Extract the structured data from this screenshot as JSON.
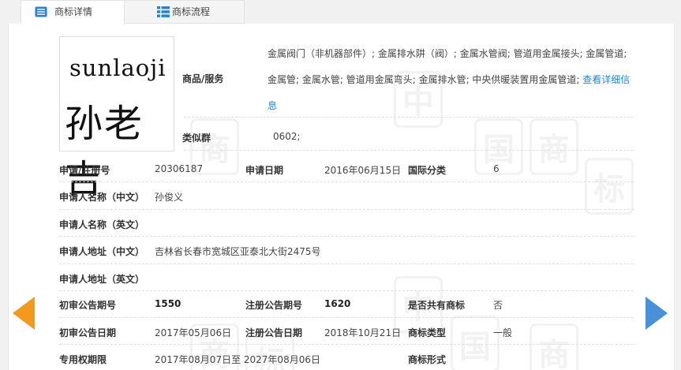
{
  "tabs": [
    {
      "label": "商标详情",
      "icon": "document-list-icon"
    },
    {
      "label": "商标流程",
      "icon": "grid-list-icon"
    }
  ],
  "logo": {
    "en": "sunlaoji",
    "cn": "孙老吉"
  },
  "goods": {
    "label": "商品/服务",
    "text": "金属阀门（非机器部件）; 金属排水阱（阀）; 金属水管阀; 管道用金属接头; 金属管道; 金属管; 金属水管; 管道用金属弯头; 金属排水管; 中央供暖装置用金属管道; ",
    "more_link": "查看详细信息"
  },
  "similar_group": {
    "label": "类似群",
    "value": "0602;"
  },
  "reg": {
    "no_label": "申请/注册号",
    "no_value": "20306187",
    "date_label": "申请日期",
    "date_value": "2016年06月15日",
    "class_label": "国际分类",
    "class_value": "6"
  },
  "applicant_cn": {
    "label": "申请人名称（中文）",
    "value": "孙俊义"
  },
  "applicant_en": {
    "label": "申请人名称（英文）",
    "value": ""
  },
  "address_cn": {
    "label": "申请人地址（中文）",
    "value": "吉林省长春市宽城区亚泰北大街2475号"
  },
  "address_en": {
    "label": "申请人地址（英文）",
    "value": ""
  },
  "announce": {
    "prelim_no_label": "初审公告期号",
    "prelim_no_value": "1550",
    "reg_no_label": "注册公告期号",
    "reg_no_value": "1620",
    "shared_label": "是否共有商标",
    "shared_value": "否"
  },
  "dates": {
    "prelim_date_label": "初审公告日期",
    "prelim_date_value": "2017年05月06日",
    "reg_date_label": "注册公告日期",
    "reg_date_value": "2018年10月21日",
    "type_label": "商标类型",
    "type_value": "一般"
  },
  "rights": {
    "period_label": "专用权期限",
    "period_value": "2017年08月07日至 2027年08月06日",
    "form_label": "商标形式",
    "form_value": ""
  },
  "nav": {
    "prev_icon": "arrow-left-icon",
    "next_icon": "arrow-right-icon"
  },
  "colors": {
    "accent_blue": "#1e88c8",
    "prev_arrow": "#f39a1e",
    "next_arrow": "#4a90d9"
  }
}
